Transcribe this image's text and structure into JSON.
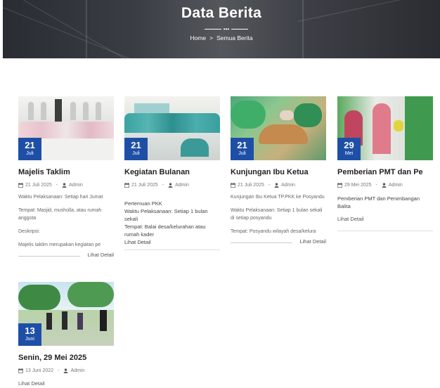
{
  "hero": {
    "title": "Data Berita",
    "breadcrumb": {
      "home": "Home",
      "separator": ">",
      "current": "Semua Berita"
    }
  },
  "posts": [
    {
      "day": "21",
      "month": "Juli",
      "title": "Majelis Taklim",
      "date": "21 Juli 2025",
      "author": "Admin",
      "lines": [
        "Waktu Pelaksanaan: Setiap hari Jumat",
        "Tempat: Masjid, musholla, atau rumah anggota",
        "Deskripsi:",
        "Majelis taklim merupakan kegiatan pe"
      ],
      "read_more": "Lihat Detail"
    },
    {
      "day": "21",
      "month": "Juli",
      "title": "Kegiatan Bulanan",
      "date": "21 Juli 2025",
      "author": "Admin",
      "lines": [
        "Pertemuan PKK",
        "Waktu Pelaksanaan: Setiap 1 bulan sekali",
        "Tempat: Balai desa/kelurahan atau rumah kader",
        "Lihat Detail"
      ]
    },
    {
      "day": "21",
      "month": "Juli",
      "title": "Kunjungan Ibu Ketua",
      "date": "21 Juli 2025",
      "author": "Admin",
      "lines": [
        "Kunjungan Ibu Ketua TP.PKK ke Posyandu",
        "Waktu Pelaksanaan: Setiap 1 bulan sekali di setiap posyandu",
        "Tempat: Posyandu wilayah desa/kelura"
      ],
      "read_more": "Lihat Detail"
    },
    {
      "day": "29",
      "month": "Mei",
      "title": "Pemberian PMT dan Pe",
      "date": "29 Mei 2025",
      "author": "Admin",
      "lines": [
        "Pemberian PMT dan Penimbangan Balita"
      ],
      "read_more": "Lihat Detail"
    },
    {
      "day": "13",
      "month": "Juni",
      "title": "Senin, 29 Mei 2025",
      "date": "13 Juni 2022",
      "author": "Admin",
      "read_more": "Lihat Detail"
    }
  ],
  "icons": {
    "date": "calendar-icon",
    "author": "user-icon"
  },
  "colors": {
    "badge": "#1e4fa6",
    "hero_bg": "#3a3d44"
  }
}
